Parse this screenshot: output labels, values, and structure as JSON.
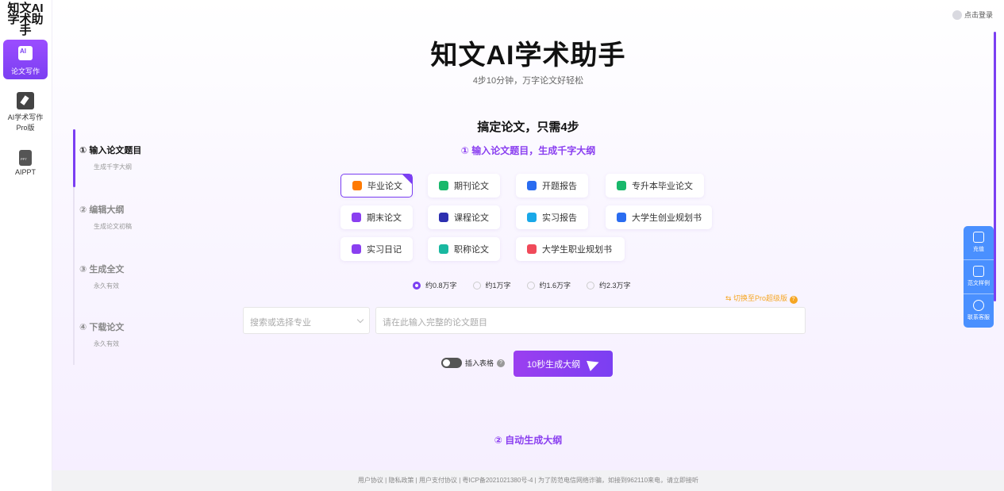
{
  "sidebar": {
    "brand": "知文AI学术助手",
    "items": [
      {
        "label": "论文写作",
        "icon": "ai-write-icon"
      },
      {
        "label": "AI学术写作Pro版",
        "icon": "pen-edit-icon"
      },
      {
        "label": "AIPPT",
        "icon": "ppt-file-icon"
      }
    ]
  },
  "header": {
    "login": "点击登录",
    "title": "知文AI学术助手",
    "subtitle": "4步10分钟，万字论文好轻松"
  },
  "section_title": "搞定论文，只需4步",
  "steps": [
    {
      "title": "① 输入论文题目",
      "sub": "生成千字大纲"
    },
    {
      "title": "② 编辑大纲",
      "sub": "生成论文初稿"
    },
    {
      "title": "③ 生成全文",
      "sub": "永久有效"
    },
    {
      "title": "④ 下载论文",
      "sub": "永久有效"
    }
  ],
  "step1_heading": "① 输入论文题目，生成千字大纲",
  "step2_heading": "② 自动生成大纲",
  "types": [
    {
      "label": "毕业论文",
      "color": "#ff7a00",
      "selected": true
    },
    {
      "label": "期刊论文",
      "color": "#19b86b"
    },
    {
      "label": "开题报告",
      "color": "#2a6cf0"
    },
    {
      "label": "专升本毕业论文",
      "color": "#19b86b"
    },
    {
      "label": "期末论文",
      "color": "#8a3ff0"
    },
    {
      "label": "课程论文",
      "color": "#2d2fb0"
    },
    {
      "label": "实习报告",
      "color": "#19a8e8"
    },
    {
      "label": "大学生创业规划书",
      "color": "#2a6cf0"
    },
    {
      "label": "实习日记",
      "color": "#8a3ff0"
    },
    {
      "label": "职称论文",
      "color": "#19b8a0"
    },
    {
      "label": "大学生职业规划书",
      "color": "#f04a5a"
    }
  ],
  "word_counts": [
    {
      "label": "约0.8万字",
      "selected": true
    },
    {
      "label": "约1万字"
    },
    {
      "label": "约1.6万字"
    },
    {
      "label": "约2.3万字"
    }
  ],
  "pro_link": "⇆ 切换至Pro超级版",
  "form": {
    "major_placeholder": "搜索或选择专业",
    "topic_placeholder": "请在此输入完整的论文题目",
    "insert_table": "插入表格",
    "generate": "10秒生成大纲"
  },
  "float": {
    "items": [
      "充值",
      "范文样例",
      "联系客服"
    ]
  },
  "footer": "用户协议 | 隐私政策 | 用户支付协议 | 粤ICP备2021021380号-4 | 为了防范电信网络诈骗，如接到962110来电，请立即接听"
}
